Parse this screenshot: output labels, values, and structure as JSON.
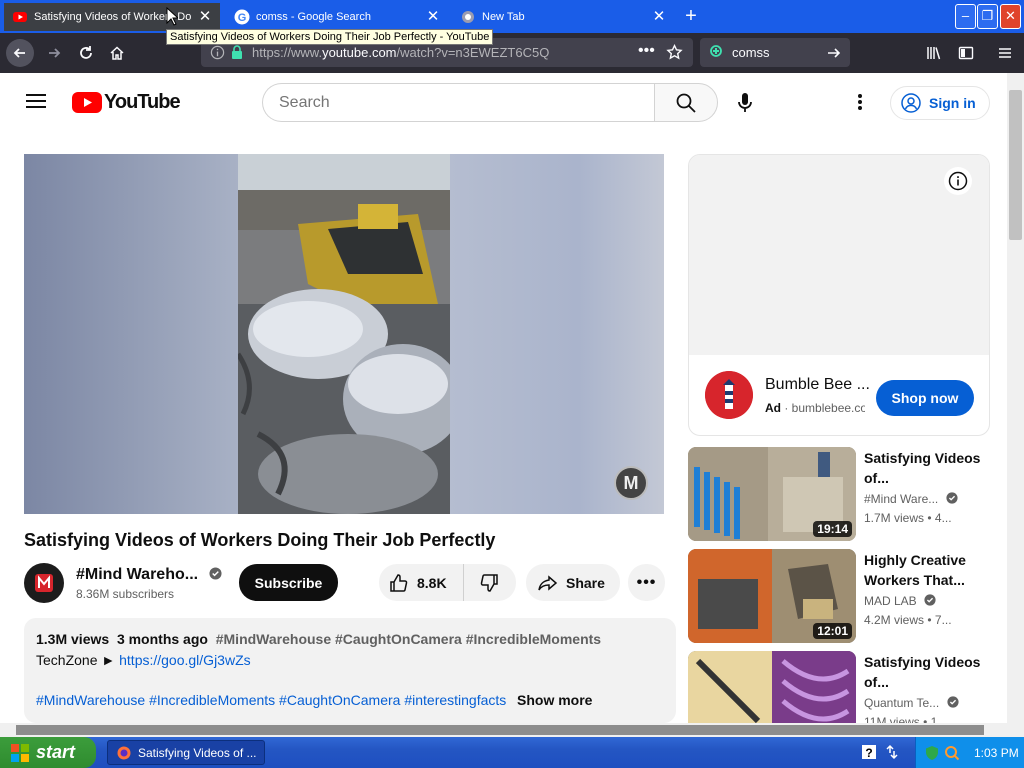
{
  "browser": {
    "tabs": [
      {
        "label": "Satisfying Videos of Workers Doing",
        "favicon": "youtube-icon",
        "active": true
      },
      {
        "label": "comss - Google Search",
        "favicon": "google-icon",
        "active": false
      },
      {
        "label": "New Tab",
        "favicon": "firefox-icon",
        "active": false
      }
    ],
    "tooltip": "Satisfying Videos of Workers Doing Their Job Perfectly - YouTube",
    "url_prefix": "https://www.",
    "url_domain": "youtube.com",
    "url_path": "/watch?v=n3EWEZT6C5Q",
    "search_query": "comss"
  },
  "youtube": {
    "logo_text": "YouTube",
    "search_placeholder": "Search",
    "sign_in": "Sign in",
    "video": {
      "title": "Satisfying Videos of Workers Doing Their Job Perfectly",
      "channel": "#Mind Wareho...",
      "subscribers": "8.36M subscribers",
      "subscribe_label": "Subscribe",
      "likes": "8.8K",
      "share_label": "Share",
      "watermark": "M"
    },
    "description": {
      "views": "1.3M views",
      "age": "3 months ago",
      "top_tags": "#MindWarehouse #CaughtOnCamera #IncredibleMoments",
      "credit_prefix": "TechZone ►",
      "credit_link": "https://goo.gl/Gj3wZs",
      "bottom_tags": "#MindWarehouse #IncredibleMoments #CaughtOnCamera #interestingfacts",
      "show_more": "Show more"
    },
    "ad": {
      "title": "Bumble Bee ...",
      "label": "Ad",
      "domain": "bumblebee.com",
      "cta": "Shop now"
    },
    "recommendations": [
      {
        "title": "Satisfying Videos of...",
        "channel": "#Mind Ware...",
        "views": "1.7M views",
        "age": "• 4...",
        "duration": "19:14"
      },
      {
        "title": "Highly Creative Workers That...",
        "channel": "MAD LAB",
        "views": "4.2M views",
        "age": "• 7...",
        "duration": "12:01"
      },
      {
        "title": "Satisfying Videos of...",
        "channel": "Quantum Te...",
        "views": "11M views",
        "age": "• 1...",
        "duration": ""
      }
    ]
  },
  "taskbar": {
    "start_label": "start",
    "window_item": "Satisfying Videos of ...",
    "clock": "1:03 PM"
  },
  "colors": {
    "youtube_red": "#ff0000",
    "link_blue": "#065fd4",
    "xp_taskbar": "#245edb",
    "xp_start_green": "#3c9d3c"
  }
}
